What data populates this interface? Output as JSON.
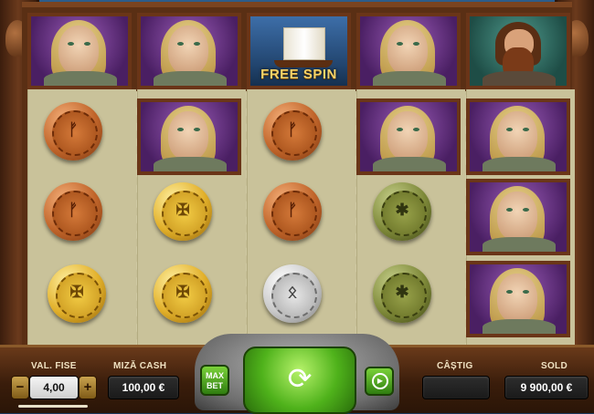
{
  "symbols": {
    "free_spin_label": "FREE SPIN",
    "coin_marks": {
      "bronze": "ᚠ",
      "gold": "✠",
      "silver": "ᛟ",
      "green": "✱"
    }
  },
  "hud": {
    "bet_level": {
      "label": "VAL. FISE",
      "value": "4,00",
      "minus": "−",
      "plus": "+"
    },
    "cash_bet": {
      "label": "MIZĂ CASH",
      "value": "100,00 €"
    },
    "max_bet": {
      "line1": "MAX",
      "line2": "BET"
    },
    "win": {
      "label": "CÂȘTIG",
      "value": ""
    },
    "balance": {
      "label": "SOLD",
      "value": "9 900,00 €"
    }
  },
  "colors": {
    "accent_green": "#4fb21b",
    "frame_brown": "#6a3518",
    "free_spin_gold": "#f3d36a"
  }
}
